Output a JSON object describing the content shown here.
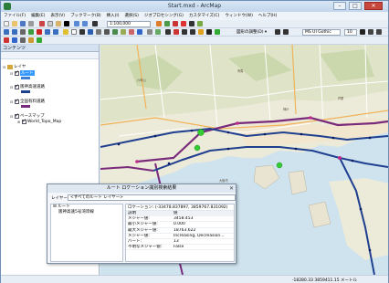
{
  "window": {
    "title": "Start.mxd - ArcMap"
  },
  "menu": [
    "ファイル(F)",
    "編集(E)",
    "表示(V)",
    "ブックマーク(B)",
    "挿入(I)",
    "選択(S)",
    "ジオプロセシング(G)",
    "カスタマイズ(C)",
    "ウィンドウ(W)",
    "ヘルプ(H)"
  ],
  "toolbar": {
    "scale": "1:100,000",
    "georef_label": "図形の調整(D) ▾",
    "font": "MS UI Gothic",
    "font_size": "10"
  },
  "toc": {
    "title": "コンテンツ",
    "layers_label": "レイヤ",
    "selected_label": "ルート",
    "items": [
      "阪神高速道路",
      "全国有料道路",
      "ベースマップ",
      "World_Topo_Map"
    ]
  },
  "dialog": {
    "title": "ルート ロケーション識別検索結果",
    "layer_label": "レイヤー:",
    "layer_value": "<すべてのルート レイヤー>",
    "tree_root": "ルート",
    "tree_child": "阪神高速5号湾岸線",
    "location": "ロケーション: (-33478.837897, 3859767.831092)",
    "header": {
      "field": "説明",
      "value": "値"
    },
    "rows": [
      {
        "field": "メジャー値:",
        "value": "3458.453"
      },
      {
        "field": "最小メジャー値:",
        "value": "0.000"
      },
      {
        "field": "最大メジャー値:",
        "value": "18763.622"
      },
      {
        "field": "メジャー値:",
        "value": "Increasing, Decreasion..."
      },
      {
        "field": "パート:",
        "value": "13"
      },
      {
        "field": "不明なメジャー値:",
        "value": "False"
      }
    ]
  },
  "status": {
    "coords": "-18280.33  3859411.15 メートル"
  },
  "colors": {
    "route_blue": "#1f3f8f",
    "route_purple": "#7a2a7a",
    "marker_green": "#33cc33",
    "water": "#cfe3ef"
  }
}
